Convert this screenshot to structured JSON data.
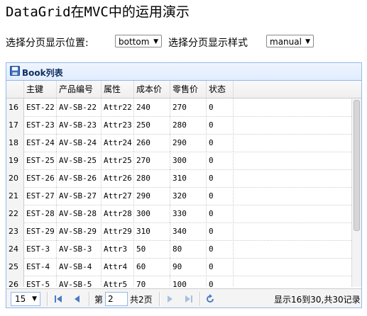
{
  "page": {
    "title": "DataGrid在MVC中的运用演示"
  },
  "controls": {
    "position_label": "选择分页显示位置:",
    "position_value": "bottom",
    "style_label": "选择分页显示样式",
    "style_value": "manual"
  },
  "panel": {
    "title": "Book列表",
    "icon": "save-icon"
  },
  "columns": [
    "主键",
    "产品编号",
    "属性",
    "成本价",
    "零售价",
    "状态"
  ],
  "rows": [
    {
      "num": "16",
      "key": "EST-22",
      "code": "AV-SB-22",
      "attr": "Attr22",
      "cost": "240",
      "price": "270",
      "status": "0"
    },
    {
      "num": "17",
      "key": "EST-23",
      "code": "AV-SB-23",
      "attr": "Attr23",
      "cost": "250",
      "price": "280",
      "status": "0"
    },
    {
      "num": "18",
      "key": "EST-24",
      "code": "AV-SB-24",
      "attr": "Attr24",
      "cost": "260",
      "price": "290",
      "status": "0"
    },
    {
      "num": "19",
      "key": "EST-25",
      "code": "AV-SB-25",
      "attr": "Attr25",
      "cost": "270",
      "price": "300",
      "status": "0"
    },
    {
      "num": "20",
      "key": "EST-26",
      "code": "AV-SB-26",
      "attr": "Attr26",
      "cost": "280",
      "price": "310",
      "status": "0"
    },
    {
      "num": "21",
      "key": "EST-27",
      "code": "AV-SB-27",
      "attr": "Attr27",
      "cost": "290",
      "price": "320",
      "status": "0"
    },
    {
      "num": "22",
      "key": "EST-28",
      "code": "AV-SB-28",
      "attr": "Attr28",
      "cost": "300",
      "price": "330",
      "status": "0"
    },
    {
      "num": "23",
      "key": "EST-29",
      "code": "AV-SB-29",
      "attr": "Attr29",
      "cost": "310",
      "price": "340",
      "status": "0"
    },
    {
      "num": "24",
      "key": "EST-3",
      "code": "AV-SB-3",
      "attr": "Attr3",
      "cost": "50",
      "price": "80",
      "status": "0"
    },
    {
      "num": "25",
      "key": "EST-4",
      "code": "AV-SB-4",
      "attr": "Attr4",
      "cost": "60",
      "price": "90",
      "status": "0"
    },
    {
      "num": "26",
      "key": "EST-5",
      "code": "AV-SB-5",
      "attr": "Attr5",
      "cost": "70",
      "price": "100",
      "status": "0"
    }
  ],
  "pager": {
    "page_size": "15",
    "page_prefix": "第",
    "current_page": "2",
    "page_suffix": "共2页",
    "info": "显示16到30,共30记录"
  },
  "colors": {
    "panel_border": "#95b8e7",
    "header_title": "#0e2d5f",
    "nav_blue": "#4a7cc4"
  }
}
